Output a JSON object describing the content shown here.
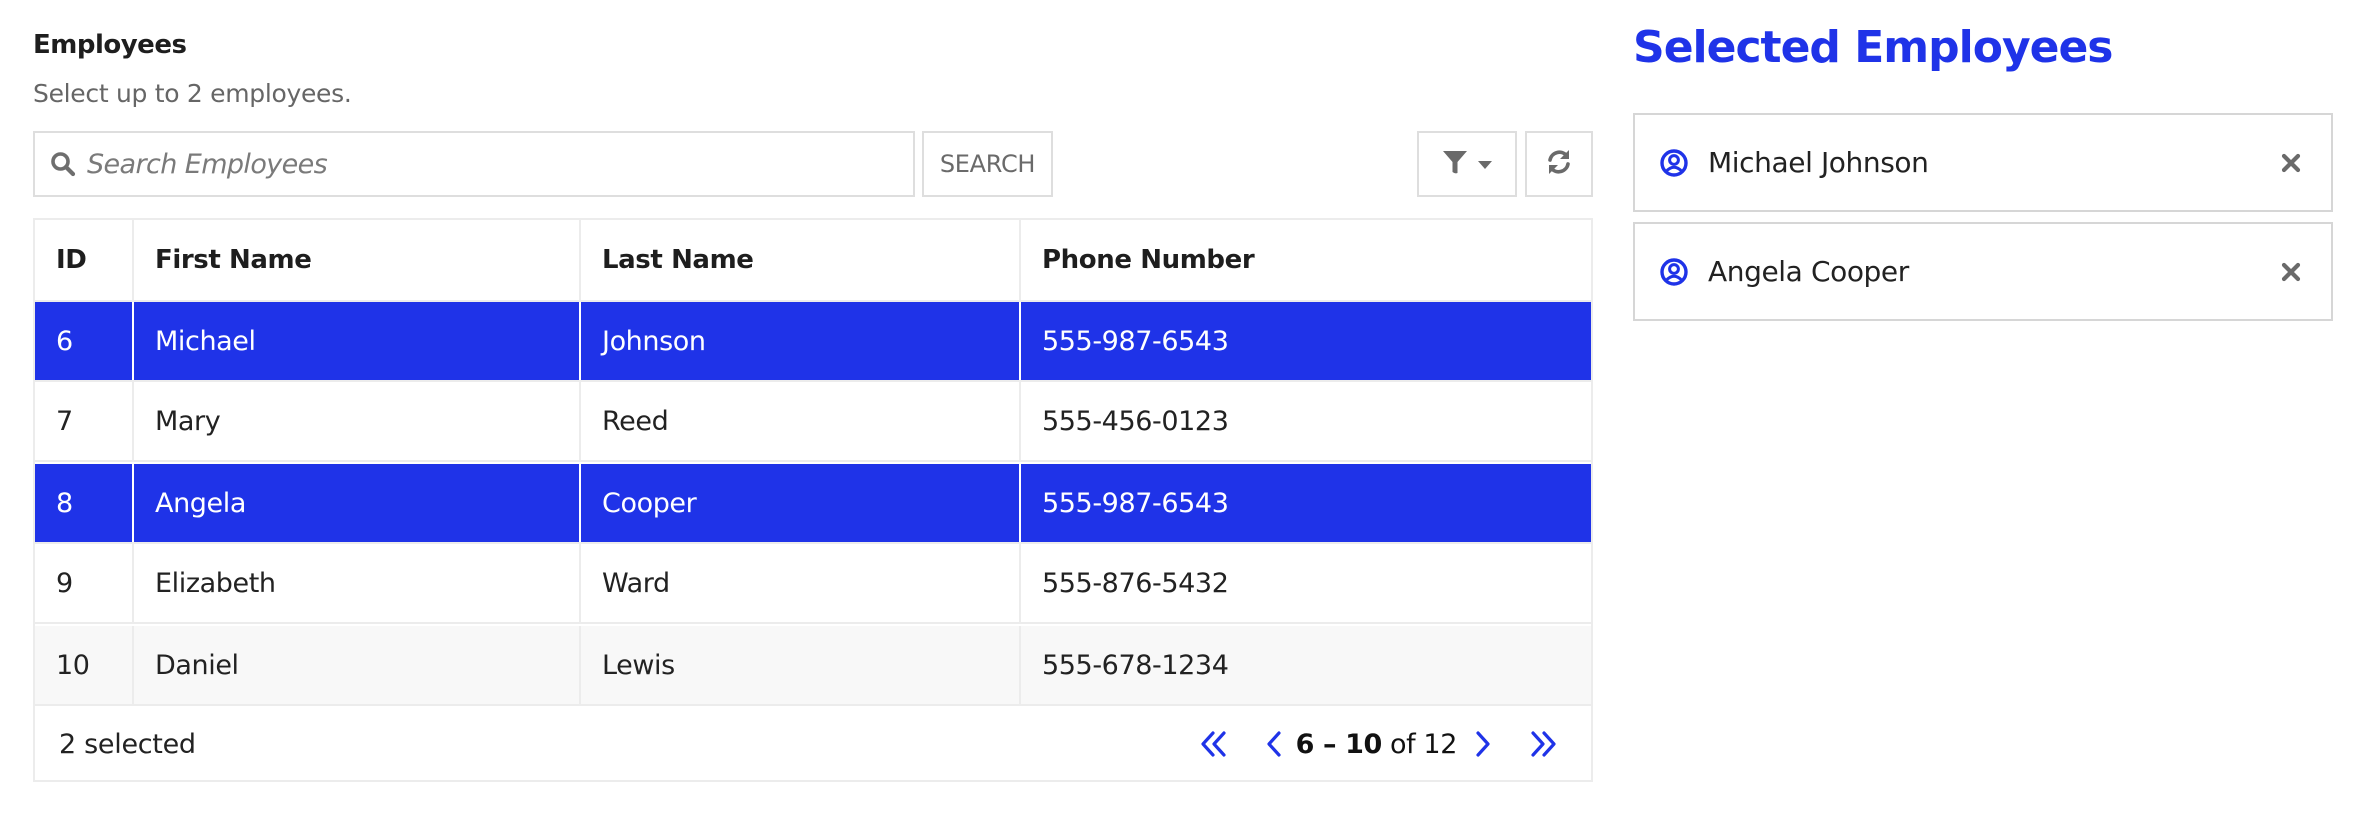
{
  "employees_panel": {
    "title": "Employees",
    "subtitle": "Select up to 2 employees.",
    "search": {
      "placeholder": "Search Employees",
      "value": "",
      "button_label": "SEARCH",
      "icon": "search-icon"
    },
    "toolbar": {
      "filter_icon": "filter-icon",
      "filter_dropdown_icon": "caret-down-icon",
      "refresh_icon": "refresh-icon"
    },
    "table": {
      "columns": [
        "ID",
        "First Name",
        "Last Name",
        "Phone Number"
      ],
      "rows": [
        {
          "id": "6",
          "first_name": "Michael",
          "last_name": "Johnson",
          "phone": "555-987-6543",
          "selected": true
        },
        {
          "id": "7",
          "first_name": "Mary",
          "last_name": "Reed",
          "phone": "555-456-0123",
          "selected": false
        },
        {
          "id": "8",
          "first_name": "Angela",
          "last_name": "Cooper",
          "phone": "555-987-6543",
          "selected": true
        },
        {
          "id": "9",
          "first_name": "Elizabeth",
          "last_name": "Ward",
          "phone": "555-876-5432",
          "selected": false
        },
        {
          "id": "10",
          "first_name": "Daniel",
          "last_name": "Lewis",
          "phone": "555-678-1234",
          "selected": false
        }
      ]
    },
    "footer": {
      "selected_count": "2 selected",
      "pager": {
        "range_bold": "6 – 10",
        "range_rest": " of 12",
        "first_icon": "chevrons-left-icon",
        "prev_icon": "chevron-left-icon",
        "next_icon": "chevron-right-icon",
        "last_icon": "chevrons-right-icon"
      }
    }
  },
  "selected_panel": {
    "title": "Selected Employees",
    "items": [
      {
        "name": "Michael Johnson",
        "icon": "user-circle-icon",
        "remove_icon": "close-icon"
      },
      {
        "name": "Angela Cooper",
        "icon": "user-circle-icon",
        "remove_icon": "close-icon"
      }
    ]
  },
  "colors": {
    "accent": "#1f33e8",
    "border": "#dedede",
    "muted_text": "#666666",
    "icon_gray": "#6a6a6a"
  }
}
